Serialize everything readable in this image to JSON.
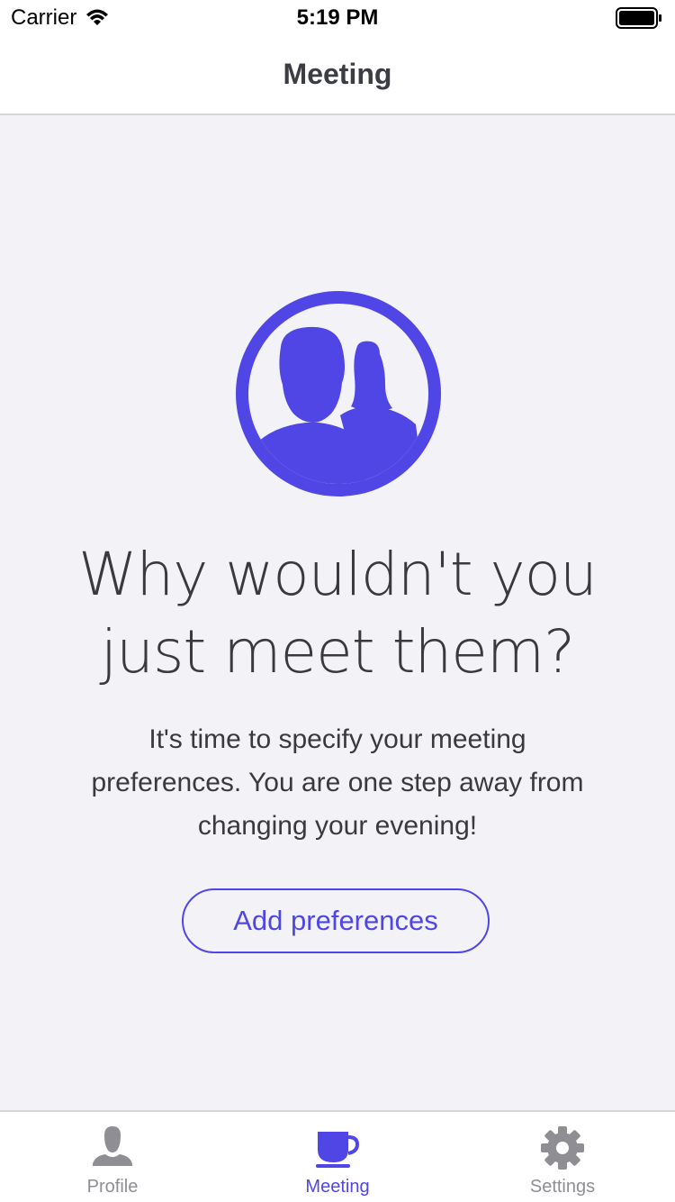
{
  "status_bar": {
    "carrier": "Carrier",
    "time": "5:19 PM"
  },
  "nav": {
    "title": "Meeting"
  },
  "main": {
    "headline_line1": "Why wouldn't you",
    "headline_line2": "just meet them?",
    "description_line1": "It's time to specify your meeting",
    "description_line2": "preferences. You are one step away from",
    "description_line3": "changing your evening!",
    "button_label": "Add preferences",
    "hero_icon": "people-icon"
  },
  "tab_bar": {
    "tabs": [
      {
        "label": "Profile",
        "icon": "person-icon",
        "active": false
      },
      {
        "label": "Meeting",
        "icon": "coffee-cup-icon",
        "active": true
      },
      {
        "label": "Settings",
        "icon": "gear-icon",
        "active": false
      }
    ]
  },
  "colors": {
    "accent": "#5046e5",
    "inactive": "#8e8e93",
    "background": "#f2f2f7"
  }
}
